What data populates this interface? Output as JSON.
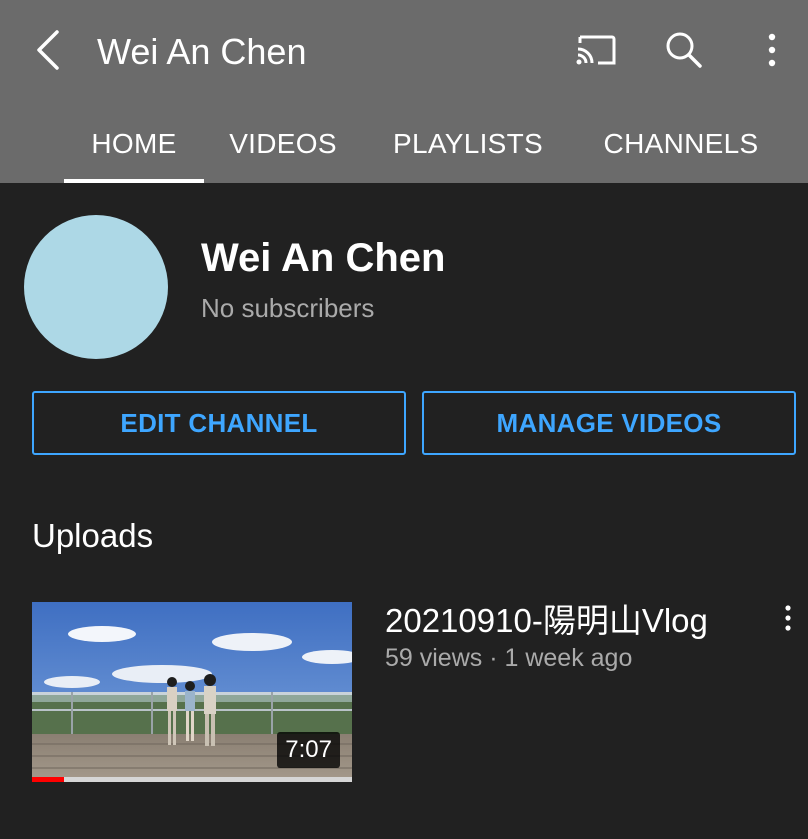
{
  "header": {
    "title": "Wei An Chen",
    "back_icon": "back-arrow-icon",
    "cast_icon": "cast-icon",
    "search_icon": "search-icon",
    "more_icon": "more-vertical-icon",
    "background": "#6b6b6b"
  },
  "tabs": [
    {
      "label": "HOME",
      "selected": true
    },
    {
      "label": "VIDEOS",
      "selected": false
    },
    {
      "label": "PLAYLISTS",
      "selected": false
    },
    {
      "label": "CHANNELS",
      "selected": false
    }
  ],
  "channel": {
    "name": "Wei An Chen",
    "subscribers": "No subscribers",
    "avatar_color": "#add8e6"
  },
  "actions": {
    "edit_label": "EDIT CHANNEL",
    "manage_label": "MANAGE VIDEOS",
    "accent": "#3ea6ff"
  },
  "uploads": {
    "heading": "Uploads",
    "videos": [
      {
        "title": "20210910-陽明山Vlog",
        "meta": "59 views · 1 week ago",
        "duration": "7:07",
        "watched_fraction": 0.1,
        "more_icon": "more-vertical-icon"
      }
    ]
  },
  "colors": {
    "page_background": "#212121",
    "secondary_text": "#aaaaaa",
    "progress_red": "#ff0000"
  }
}
